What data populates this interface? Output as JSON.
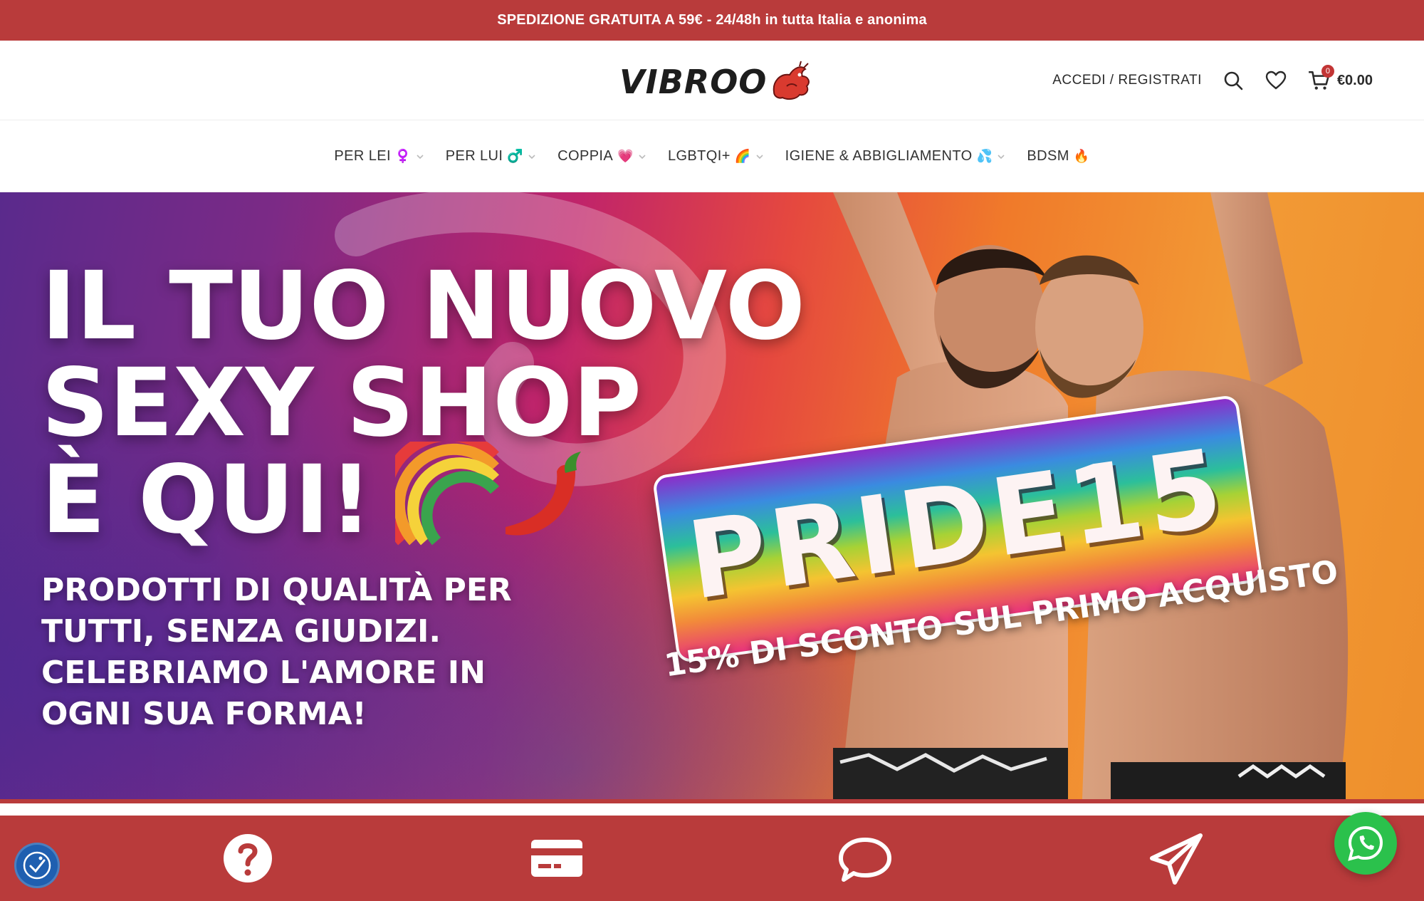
{
  "promo": {
    "text": "SPEDIZIONE GRATUITA A 59€ - 24/48h in tutta Italia e anonima"
  },
  "header": {
    "logo_text": "VIBROO",
    "account_label": "ACCEDI / REGISTRATI",
    "cart_count": "0",
    "cart_total": "€0.00"
  },
  "nav": {
    "items": [
      {
        "label": "PER LEI",
        "emoji": "♀️"
      },
      {
        "label": "PER LUI",
        "emoji": "♂️"
      },
      {
        "label": "COPPIA",
        "emoji": "💗"
      },
      {
        "label": "LGBTQI+",
        "emoji": "🌈"
      },
      {
        "label": "IGIENE & ABBIGLIAMENTO",
        "emoji": "💦"
      },
      {
        "label": "BDSM",
        "emoji": "🔥"
      }
    ]
  },
  "hero": {
    "title_lines": [
      "IL TUO NUOVO",
      "SEXY SHOP",
      "È QUI!"
    ],
    "subtitle_lines": [
      "PRODOTTI DI QUALITÀ PER",
      "TUTTI, SENZA GIUDIZI.",
      "CELEBRIAMO L'AMORE IN",
      "OGNI SUA FORMA!"
    ],
    "coupon_code": "PRIDE15",
    "coupon_caption": "15% DI SCONTO SUL PRIMO ACQUISTO"
  },
  "colors": {
    "brand_red": "#b93b3b",
    "whatsapp_green": "#2bc14c",
    "a11y_blue": "#1f5fb0"
  },
  "icons": {
    "features": [
      "question-icon",
      "credit-card-icon",
      "chat-bubble-icon",
      "paper-plane-icon"
    ]
  }
}
